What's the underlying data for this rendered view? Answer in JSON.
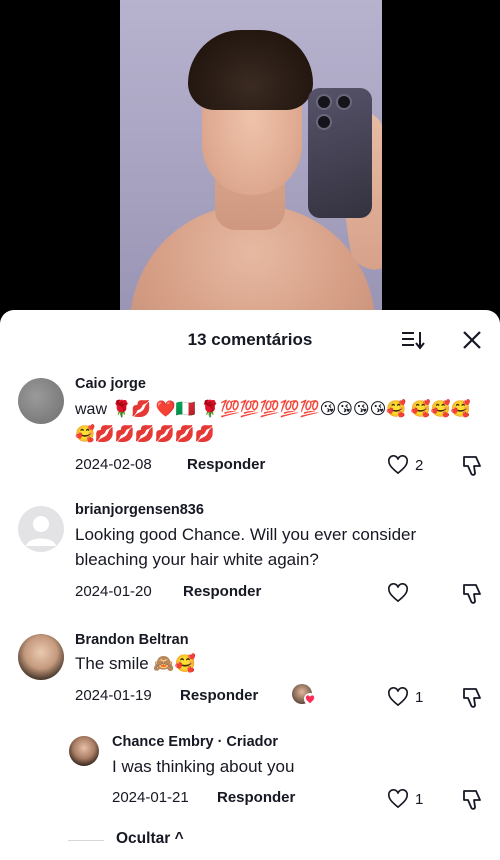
{
  "video": {
    "description_icon": "video-preview"
  },
  "comments_sheet": {
    "title": "13 comentários",
    "sort_icon": "sort-icon",
    "close_icon": "close-icon"
  },
  "comments": [
    {
      "user": "Caio jorge",
      "text": "waw 🌹💋 ❤️🇮🇹 🌹💯💯💯💯💯😘😘😘😘🥰 🥰🥰🥰🥰💋💋💋💋💋💋",
      "date": "2024-02-08",
      "reply_label": "Responder",
      "likes": "2"
    },
    {
      "user": "brianjorgensen836",
      "text": "Looking good Chance. Will you ever consider bleaching your hair white again?",
      "date": "2024-01-20",
      "reply_label": "Responder",
      "likes": ""
    },
    {
      "user": "Brandon Beltran",
      "text": "The smile 🙈🥰",
      "date": "2024-01-19",
      "reply_label": "Responder",
      "likes": "1"
    }
  ],
  "reply": {
    "user": "Chance Embry · Criador",
    "text": "I was thinking about you",
    "date": "2024-01-21",
    "reply_label": "Responder",
    "likes": "1"
  },
  "hide_label": "Ocultar ^",
  "colors": {
    "text": "#161823",
    "heart_liked": "#fe2c55",
    "sheet_bg": "#ffffff"
  }
}
